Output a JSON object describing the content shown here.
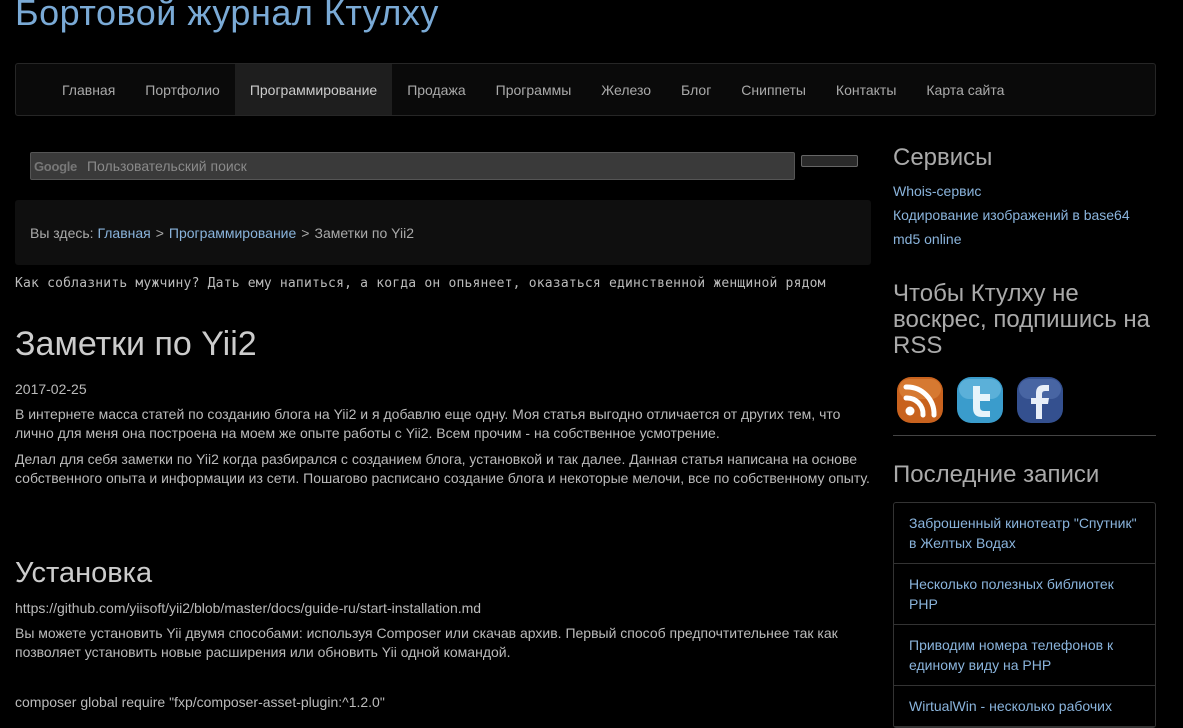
{
  "header": {
    "title": "Бортовой журнал Ктулху"
  },
  "nav": {
    "items": [
      {
        "label": "Главная"
      },
      {
        "label": "Портфолио"
      },
      {
        "label": "Программирование",
        "active": true
      },
      {
        "label": "Продажа"
      },
      {
        "label": "Программы"
      },
      {
        "label": "Железо"
      },
      {
        "label": "Блог"
      },
      {
        "label": "Сниппеты"
      },
      {
        "label": "Контакты"
      },
      {
        "label": "Карта сайта"
      }
    ]
  },
  "search": {
    "logo": "Google",
    "placeholder": "Пользовательский поиск",
    "button_label": ""
  },
  "breadcrumb": {
    "prefix": "Вы здесь:",
    "home": "Главная",
    "sep": ">",
    "section": "Программирование",
    "current": "Заметки по Yii2"
  },
  "quote": "Как соблазнить мужчину? Дать ему напиться, а когда он опьянеет, оказаться единственной женщиной рядом",
  "article": {
    "title": "Заметки по Yii2",
    "date": "2017-02-25",
    "p1": "В интернете масса статей по созданию блога на Yii2 и я добавлю еще одну. Моя статья выгодно отличается от других тем, что лично для меня она построена на моем же опыте работы с Yii2. Всем прочим - на собственное усмотрение.",
    "p2": "Делал для себя заметки по Yii2 когда разбирался с созданием блога, установкой и так далее. Данная статья написана на основе собственного опыта и информации из сети. Пошагово расписано создание блога и некоторые мелочи, все по собственному опыту.",
    "section_title": "Установка",
    "link": "https://github.com/yiisoft/yii2/blob/master/docs/guide-ru/start-installation.md",
    "p3": "Вы можете установить Yii двумя способами: используя Composer или скачав архив. Первый способ предпочтительнее так как позволяет установить новые расширения или обновить Yii одной командой.",
    "code": "composer global require \"fxp/composer-asset-plugin:^1.2.0\""
  },
  "sidebar": {
    "services_title": "Сервисы",
    "services": [
      "Whois-сервис",
      "Кодирование изображений в base64",
      "md5 online"
    ],
    "rss_title": "Чтобы Ктулху не воскрес, подпишись на RSS",
    "social": [
      {
        "icon": "rss-icon",
        "color": "#e07b28"
      },
      {
        "icon": "twitter-icon",
        "color": "#4aa8d8"
      },
      {
        "icon": "facebook-icon",
        "color": "#3b5998"
      }
    ],
    "recent_title": "Последние записи",
    "recent": [
      "Заброшенный кинотеатр \"Спутник\" в Желтых Водах",
      "Несколько полезных библиотек PHP",
      "Приводим номера телефонов к единому виду на PHP",
      "WirtualWin - несколько рабочих"
    ]
  }
}
